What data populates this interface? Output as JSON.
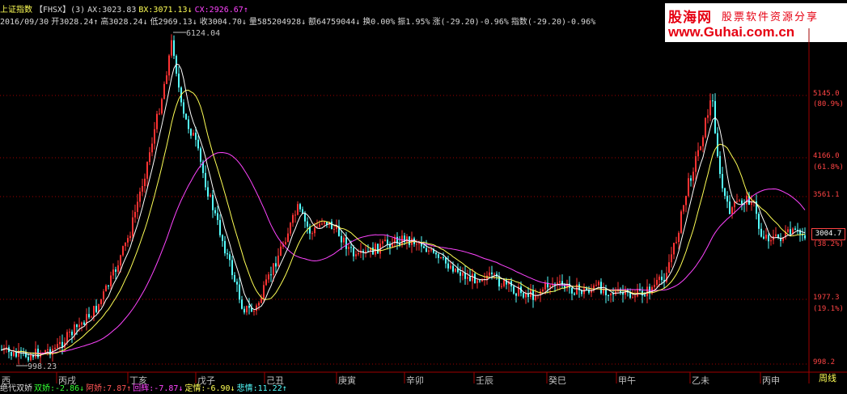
{
  "info_row1": {
    "index_name": "上证指数",
    "code": "【FHSX】(3)",
    "ax": "AX:3023.83",
    "bx": "BX:3071.13↓",
    "cx": "CX:2926.67↑"
  },
  "info_row2": {
    "date": "2016/09/30",
    "open": "开3028.24↑",
    "high": "高3028.24↓",
    "low": "低2969.13↓",
    "close": "收3004.70↓",
    "volume": "量585204928↓",
    "amount": "额64759044↓",
    "turnover": "换0.00%",
    "amplitude": "振1.95%",
    "change": "涨(-29.20)-0.96%",
    "index_change": "指数(-29.20)-0.96%"
  },
  "logo": {
    "brand": "股海网",
    "slogan": "股票软件资源分享",
    "url": "www.Guhai.com.cn"
  },
  "y_axis": [
    {
      "value": "5145.0",
      "pct": "(80.9%)"
    },
    {
      "value": "4166.0",
      "pct": "(61.8%)"
    },
    {
      "value": "3561.1",
      "pct": ""
    },
    {
      "value": "1977.3",
      "pct": "(19.1%)"
    },
    {
      "value": "998.2",
      "pct": ""
    }
  ],
  "current_price": "3004.7",
  "current_pct": "(38.2%)",
  "annotations": {
    "high": "6124.04",
    "low": "998.23"
  },
  "x_axis": [
    "西",
    "丙戌",
    "丁亥",
    "戊子",
    "己丑",
    "庚寅",
    "辛卯",
    "壬辰",
    "癸巳",
    "甲午",
    "乙未",
    "丙申"
  ],
  "period_button": "周线",
  "bottom_row": {
    "name": "绝代双娇",
    "a": "双娇:-2.86↓",
    "b": "阿娇:7.87↑",
    "c": "回辉:-7.87↓",
    "d": "定情:-6.90↓",
    "e": "悲情:11.22↑"
  },
  "colors": {
    "up": "#ff3333",
    "down": "#55ffff",
    "ma_short": "#ffffff",
    "ma_mid": "#ffff55",
    "ma_long": "#ff44ff",
    "grid": "#a00000"
  }
}
